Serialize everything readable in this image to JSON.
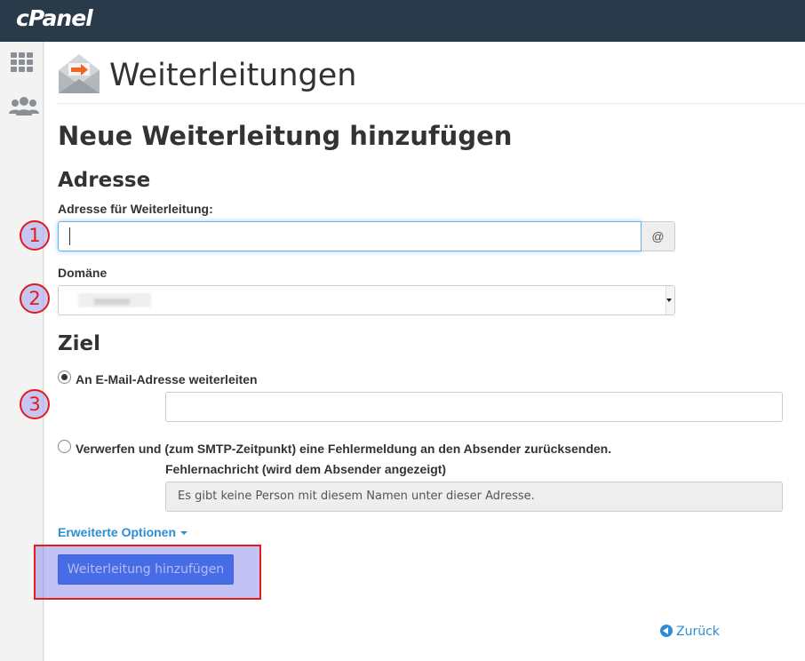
{
  "app": {
    "logo": "cPanel"
  },
  "sidebar": {
    "icons": [
      "apps-grid-icon",
      "users-group-icon"
    ]
  },
  "page": {
    "title": "Weiterleitungen",
    "section_title": "Neue Weiterleitung hinzufügen"
  },
  "address": {
    "heading": "Adresse",
    "label": "Adresse für Weiterleitung:",
    "value": "",
    "addon": "@",
    "domain_label": "Domäne",
    "domain_value": ""
  },
  "target": {
    "heading": "Ziel",
    "option_forward_label": "An E-Mail-Adresse weiterleiten",
    "option_forward_checked": true,
    "forward_email_value": "",
    "option_discard_label": "Verwerfen und (zum SMTP-Zeitpunkt) eine Fehlermeldung an den Absender zurücksenden.",
    "option_discard_checked": false,
    "error_label": "Fehlernachricht (wird dem Absender angezeigt)",
    "error_placeholder": "Es gibt keine Person mit diesem Namen unter dieser Adresse."
  },
  "advanced_options": "Erweiterte Optionen",
  "submit_label": "Weiterleitung hinzufügen",
  "back_label": "Zurück",
  "annotations": {
    "step1": "1",
    "step2": "2",
    "step3": "3"
  },
  "colors": {
    "topbar": "#293a4a",
    "link": "#2c8dd2",
    "primary_button": "#1e64e6",
    "annotation_red": "#e21b1b"
  }
}
